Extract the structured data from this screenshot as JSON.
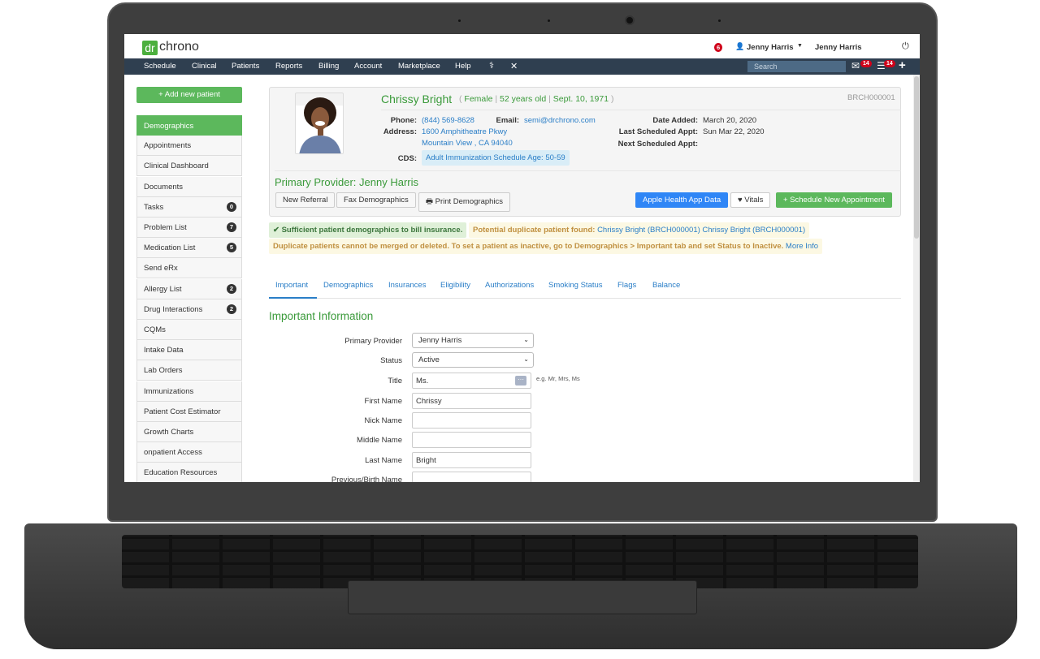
{
  "app": {
    "logo_dr": "dr",
    "logo_chrono": "chrono",
    "notifications": "6",
    "user": "Jenny Harris",
    "user2": "Jenny Harris"
  },
  "nav": {
    "items": [
      "Schedule",
      "Clinical",
      "Patients",
      "Reports",
      "Billing",
      "Account",
      "Marketplace",
      "Help"
    ],
    "search_placeholder": "Search",
    "mail_count": "14",
    "tasks_count": "14"
  },
  "sidebar": {
    "add_button": "+ Add new patient",
    "items": [
      {
        "label": "Demographics"
      },
      {
        "label": "Appointments"
      },
      {
        "label": "Clinical Dashboard"
      },
      {
        "label": "Documents"
      },
      {
        "label": "Tasks",
        "count": "0"
      },
      {
        "label": "Problem List",
        "count": "7"
      },
      {
        "label": "Medication List",
        "count": "5"
      },
      {
        "label": "Send eRx"
      },
      {
        "label": "Allergy List",
        "count": "2"
      },
      {
        "label": "Drug Interactions",
        "count": "2"
      },
      {
        "label": "CQMs"
      },
      {
        "label": "Intake Data"
      },
      {
        "label": "Lab Orders"
      },
      {
        "label": "Immunizations"
      },
      {
        "label": "Patient Cost Estimator"
      },
      {
        "label": "Growth Charts"
      },
      {
        "label": "onpatient Access"
      },
      {
        "label": "Education Resources"
      }
    ]
  },
  "patient": {
    "name": "Chrissy Bright",
    "gender": "Female",
    "age": "52 years old",
    "dob": "Sept. 10, 1971",
    "chart_id": "BRCH000001",
    "phone_label": "Phone:",
    "phone": "(844) 569-8628",
    "email_label": "Email:",
    "email": "semi@drchrono.com",
    "address_label": "Address:",
    "address1": "1600 Amphitheatre Pkwy",
    "address2": "Mountain View , CA 94040",
    "cds_label": "CDS:",
    "cds": "Adult Immunization Schedule Age: 50-59",
    "date_added_label": "Date Added:",
    "date_added": "March 20, 2020",
    "last_appt_label": "Last Scheduled Appt:",
    "last_appt": "Sun Mar 22, 2020",
    "next_appt_label": "Next Scheduled Appt:",
    "primary_provider": "Primary Provider: Jenny Harris"
  },
  "buttons": {
    "new_referral": "New Referral",
    "fax": "Fax Demographics",
    "print": "Print Demographics",
    "apple": "Apple Health App Data",
    "vitals": "Vitals",
    "schedule": "+ Schedule New Appointment"
  },
  "alerts": {
    "sufficient": "✔ Sufficient patient demographics to bill insurance.",
    "dup_prefix": "Potential duplicate patient found:",
    "dup_links": "Chrissy Bright (BRCH000001) Chrissy Bright (BRCH000001)",
    "merge": "Duplicate patients cannot be merged or deleted. To set a patient as inactive, go to Demographics > Important tab and set Status to Inactive.",
    "more_info": "More Info"
  },
  "tabs": [
    "Important",
    "Demographics",
    "Insurances",
    "Eligibility",
    "Authorizations",
    "Smoking Status",
    "Flags",
    "Balance"
  ],
  "form": {
    "heading": "Important Information",
    "primary_provider_label": "Primary Provider",
    "primary_provider": "Jenny Harris",
    "status_label": "Status",
    "status": "Active",
    "title_label": "Title",
    "title": "Ms.",
    "title_hint": "e.g. Mr, Mrs, Ms",
    "first_label": "First Name",
    "first": "Chrissy",
    "nick_label": "Nick Name",
    "middle_label": "Middle Name",
    "last_label": "Last Name",
    "last": "Bright",
    "prev_label": "Previous/Birth Name"
  },
  "colors": {
    "green": "#5cb85c",
    "nav": "#2f3f50",
    "link": "#2a7ec7",
    "blue_button": "#2f86f6"
  }
}
